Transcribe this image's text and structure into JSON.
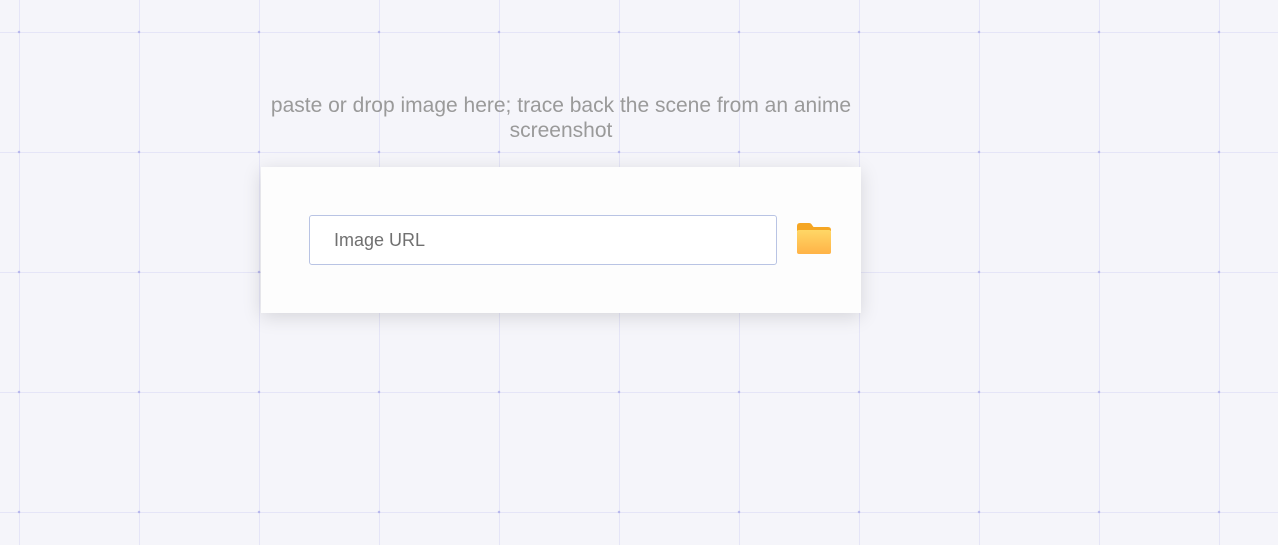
{
  "hint": {
    "line1": "paste or drop image here; trace back the scene from an anime",
    "line2": "screenshot"
  },
  "search": {
    "placeholder": "Image URL",
    "value": ""
  },
  "file_picker": {
    "icon": "folder-icon",
    "color": "#ffc94d"
  },
  "colors": {
    "background": "#f5f5fa",
    "card": "#fdfdfd",
    "input_border": "#b9c4e4",
    "hint_text": "#9a9a9a"
  }
}
